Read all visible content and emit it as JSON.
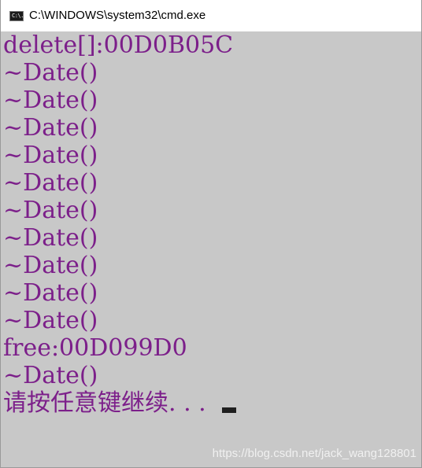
{
  "window": {
    "title": "C:\\WINDOWS\\system32\\cmd.exe",
    "icon_glyph": "C:\\."
  },
  "console": {
    "text_color": "#7c1f8a",
    "background_color": "#c8c8c8",
    "lines": [
      "delete[]:00D0B05C",
      "~Date()",
      "~Date()",
      "~Date()",
      "~Date()",
      "~Date()",
      "~Date()",
      "~Date()",
      "~Date()",
      "~Date()",
      "~Date()",
      "free:00D099D0",
      "~Date()"
    ],
    "prompt": "请按任意键继续. . ."
  },
  "watermark": "https://blog.csdn.net/jack_wang128801"
}
